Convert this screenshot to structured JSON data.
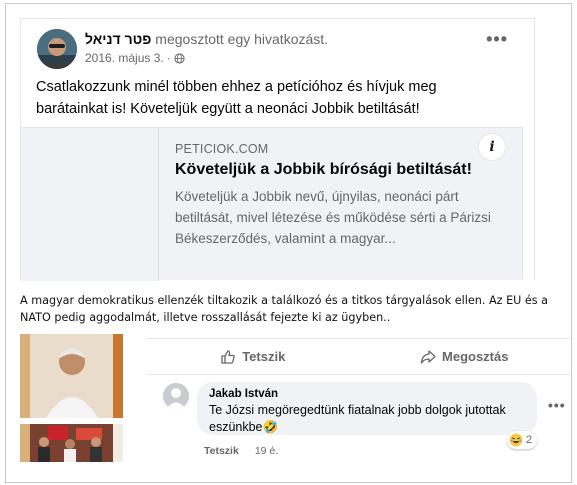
{
  "post": {
    "author": "פטר דניאל",
    "action": " megosztott egy hivatkozást.",
    "date": "2016. május 3.",
    "more_label": "•••",
    "text": "Csatlakozzunk minél többen ehhez a petícióhoz és hívjuk meg barátainkat is! Követeljük együtt a neonáci Jobbik betiltását!",
    "link": {
      "domain": "PETICIOK.COM",
      "title": "Követeljük a Jobbik bírósági betiltását!",
      "description": "Követeljük a Jobbik nevű, újnyilas, neonáci párt betiltását, mivel létezése és működése sérti a Párizsi Békeszerződés, valamint a magyar...",
      "info_label": "i"
    }
  },
  "caption": "A magyar demokratikus ellenzék tiltakozik a találkozó és a titkos tárgyalások ellen. Az EU és a NATO pedig aggodalmát, illetve rosszallását fejezte ki az ügyben..",
  "actions": {
    "like_label": "Tetszik",
    "share_label": "Megosztás"
  },
  "comment": {
    "author": "Jakab István",
    "text": "Te Józsi megöregedtünk fiatalnak jobb dolgok jutottak eszünkbe🤣",
    "reaction_count": "2",
    "like_label": "Tetszik",
    "time": "19 é.",
    "more_label": "•••"
  },
  "colors": {
    "secondary_text": "#65676b",
    "bubble_bg": "#f0f2f5",
    "border": "#e4e6eb"
  },
  "icons": {
    "globe": "globe-icon",
    "like": "thumbs-up-icon",
    "share": "share-arrow-icon",
    "reaction": "laughing-emoji-icon",
    "info": "info-icon"
  }
}
